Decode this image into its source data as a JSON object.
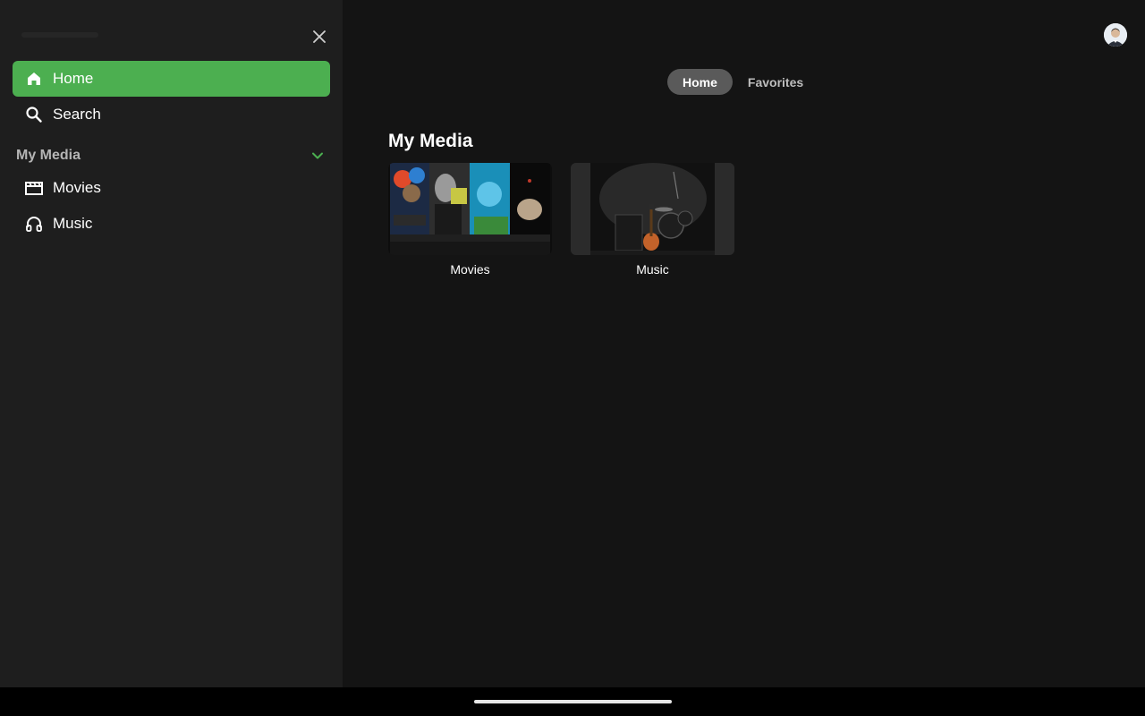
{
  "sidebar": {
    "nav": [
      {
        "label": "Home",
        "icon": "home-icon",
        "active": true
      },
      {
        "label": "Search",
        "icon": "search-icon",
        "active": false
      }
    ],
    "section_label": "My Media",
    "section_items": [
      {
        "label": "Movies",
        "icon": "movie-icon"
      },
      {
        "label": "Music",
        "icon": "headphones-icon"
      }
    ]
  },
  "header": {
    "tabs": [
      {
        "label": "Home",
        "active": true
      },
      {
        "label": "Favorites",
        "active": false
      }
    ]
  },
  "main": {
    "section_title": "My Media",
    "cards": [
      {
        "label": "Movies",
        "thumbnail": "movie-posters-collage"
      },
      {
        "label": "Music",
        "thumbnail": "guitar-drums-photo"
      }
    ]
  },
  "colors": {
    "accent": "#4caf50",
    "sidebar_bg": "#1e1e1e",
    "main_bg": "#141414",
    "tab_active_bg": "#5a5a5a"
  }
}
